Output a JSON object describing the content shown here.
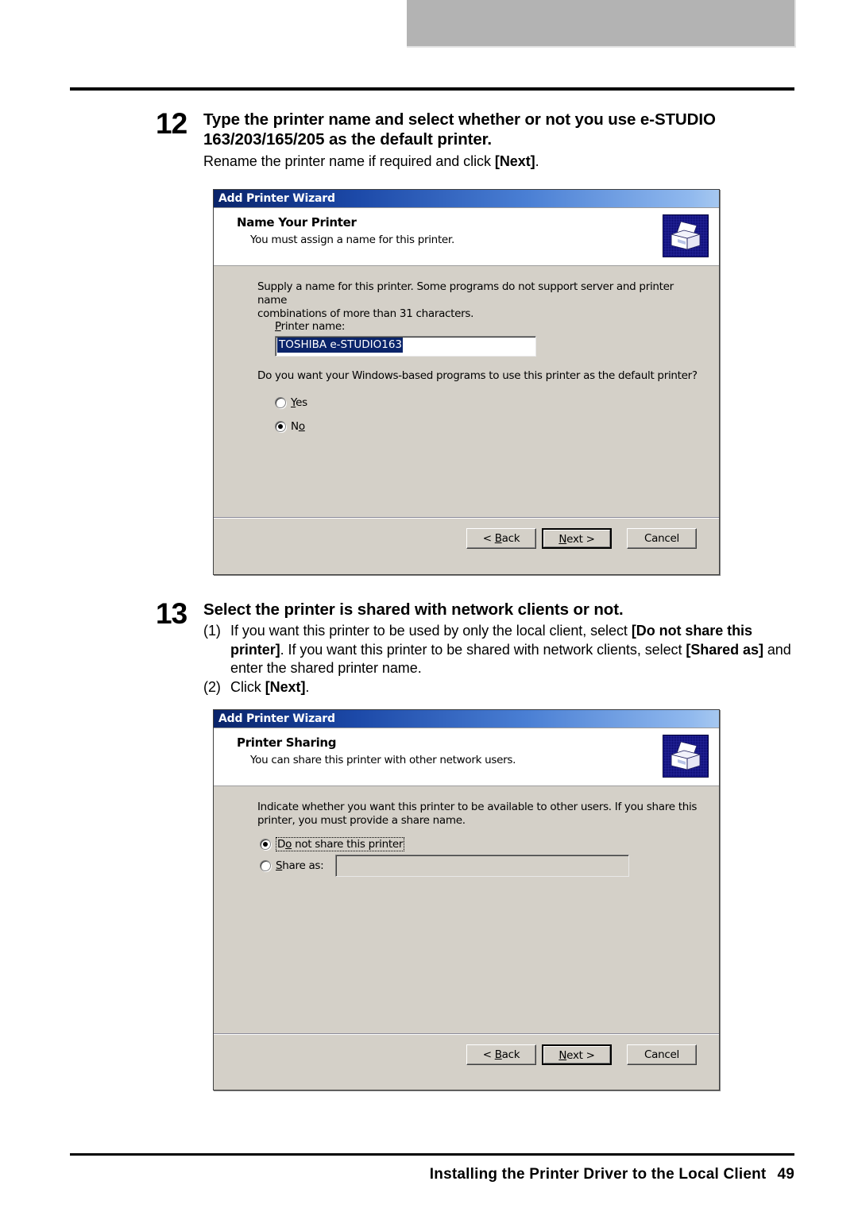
{
  "page": {
    "footer_text": "Installing the Printer Driver to the Local Client",
    "page_number": "49"
  },
  "steps": [
    {
      "number": "12",
      "title": "Type the printer name and select whether or not you use e-STUDIO 163/203/165/205 as the default printer.",
      "text_pre": "Rename the printer name if required and click ",
      "text_bold": "[Next]",
      "text_post": "."
    },
    {
      "number": "13",
      "title": "Select the printer is shared with network clients or not.",
      "items": [
        {
          "marker": "(1)",
          "seg1": "If you want this printer to be used by only the local client, select ",
          "bold1": "[Do not share this printer]",
          "seg2": ". If you want this printer to be shared with network clients, select ",
          "bold2": "[Shared as]",
          "seg3": " and enter the shared printer name."
        },
        {
          "marker": "(2)",
          "seg1": "Click ",
          "bold1": "[Next]",
          "seg2": "."
        }
      ]
    }
  ],
  "dialog_name_printer": {
    "titlebar": "Add Printer Wizard",
    "header_title": "Name Your Printer",
    "header_sub": "You must assign a name for this printer.",
    "icon": "printer-icon",
    "body_text_line1": "Supply a name for this printer. Some programs do not support server and printer name",
    "body_text_line2": "combinations of more than 31 characters.",
    "printer_name_label_accel": "P",
    "printer_name_label_rest": "rinter name:",
    "printer_name_value": "TOSHIBA e-STUDIO163",
    "question": "Do you want your Windows-based programs to use this printer as the default printer?",
    "radios": [
      {
        "accel": "Y",
        "rest": "es",
        "checked": false
      },
      {
        "accel": "N",
        "pre": "N",
        "accel_char": "o",
        "rest": "",
        "checked": true
      }
    ],
    "radio_yes_pre": "",
    "radio_yes_accel": "Y",
    "radio_yes_rest": "es",
    "radio_no_pre": "N",
    "radio_no_accel": "o",
    "radio_no_rest": "",
    "buttons": {
      "back_pre": "< ",
      "back_accel": "B",
      "back_rest": "ack",
      "next_accel": "N",
      "next_rest": "ext >",
      "cancel": "Cancel"
    }
  },
  "dialog_printer_sharing": {
    "titlebar": "Add Printer Wizard",
    "header_title": "Printer Sharing",
    "header_sub": "You can share this printer with other network users.",
    "icon": "printer-icon",
    "body_text_line1": "Indicate whether you want this printer to be available to other users. If you share this",
    "body_text_line2": "printer, you must provide a share name.",
    "radio_donotshare_pre": "D",
    "radio_donotshare_accel": "o",
    "radio_donotshare_rest": " not share this printer",
    "radio_shareas_accel": "S",
    "radio_shareas_rest": "hare as:",
    "share_name_value": "",
    "buttons": {
      "back_pre": "< ",
      "back_accel": "B",
      "back_rest": "ack",
      "next_accel": "N",
      "next_rest": "ext >",
      "cancel": "Cancel"
    }
  },
  "colors": {
    "titlebar_start": "#0a246a",
    "titlebar_end": "#a6c8f0",
    "dialog_face": "#d4d0c8",
    "selection": "#0a246a",
    "icon_background": "#000060"
  }
}
